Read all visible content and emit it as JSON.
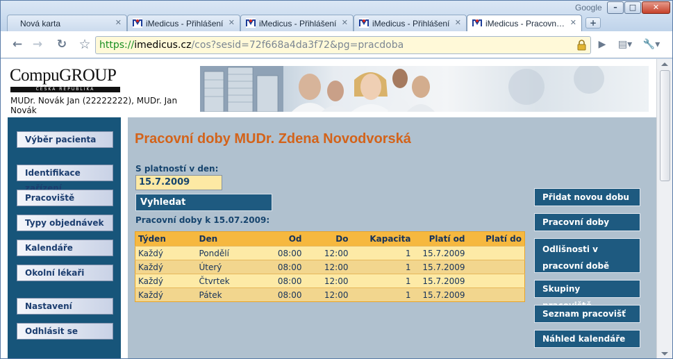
{
  "browser": {
    "google_label": "Google",
    "tabs": [
      {
        "label": "Nová karta",
        "active": false
      },
      {
        "label": "iMedicus - Přihlášení",
        "active": false
      },
      {
        "label": "iMedicus - Přihlášení",
        "active": false
      },
      {
        "label": "iMedicus - Přihlášení",
        "active": false
      },
      {
        "label": "iMedicus - Pracovn…",
        "active": true
      }
    ],
    "url": {
      "scheme": "https://",
      "host": "imedicus.cz",
      "rest": "/cos?sesid=72f668a4da3f72&pg=pracdoba"
    }
  },
  "header": {
    "logo": "CompuGROUP",
    "logo_sub": "ČESKÁ REPUBLIKA",
    "doctor": "MUDr. Novák Jan (22222222), MUDr. Jan Novák"
  },
  "leftnav": {
    "items": [
      "Výběr pacienta",
      "Identifikace zařízení",
      "Pracoviště",
      "Typy objednávek",
      "Kalendáře",
      "Okolní lékaři",
      "Nastavení",
      "Odhlásit se"
    ]
  },
  "main": {
    "heading": "Pracovní doby MUDr. Zdena Novodvorská",
    "valid_label": "S platností v den:",
    "date_value": "15.7.2009",
    "search_label": "Vyhledat",
    "list_label": "Pracovní doby k 15.07.2009:",
    "table": {
      "columns": [
        "Týden",
        "Den",
        "Od",
        "Do",
        "Kapacita",
        "Platí od",
        "Platí do"
      ],
      "rows": [
        [
          "Každý",
          "Pondělí",
          "08:00",
          "12:00",
          "1",
          "15.7.2009",
          ""
        ],
        [
          "Každý",
          "Úterý",
          "08:00",
          "12:00",
          "1",
          "15.7.2009",
          ""
        ],
        [
          "Každý",
          "Čtvrtek",
          "08:00",
          "12:00",
          "1",
          "15.7.2009",
          ""
        ],
        [
          "Každý",
          "Pátek",
          "08:00",
          "12:00",
          "1",
          "15.7.2009",
          ""
        ]
      ]
    }
  },
  "rightnav": {
    "items": [
      "Přidat novou dobu",
      "Pracovní doby",
      "Odlišnosti v pracovní době",
      "Skupiny pracoviště",
      "Seznam pracovišť",
      "Náhled kalendáře"
    ]
  },
  "colors": {
    "nav_blue": "#17557a",
    "heading_orange": "#d3631a",
    "table_header": "#f6b83f",
    "main_bg": "#b0c1cf"
  }
}
